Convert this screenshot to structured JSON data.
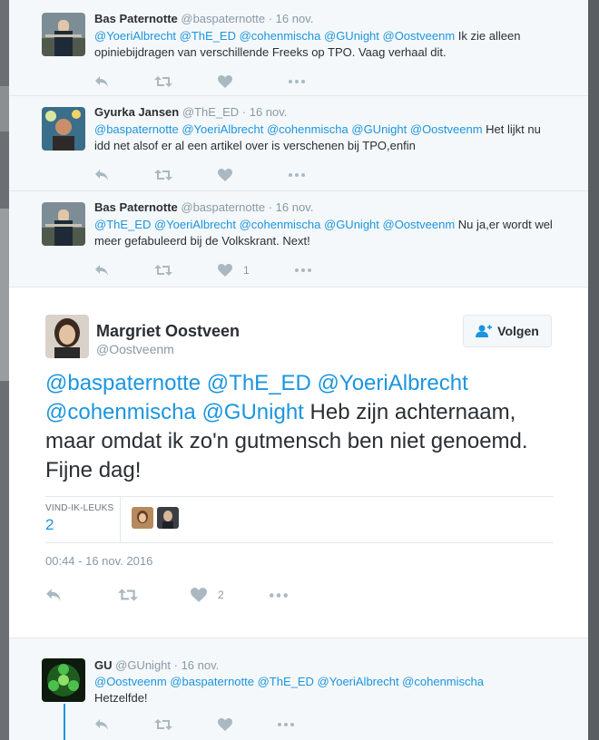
{
  "tweets": [
    {
      "name": "Bas Paternotte",
      "handle": "@baspaternotte",
      "time": "· 16 nov.",
      "mentions": "@YoeriAlbrecht @ThE_ED @cohenmischa @GUnight @Oostveenm",
      "text": " Ik zie alleen opiniebijdragen van verschillende Freeks op TPO. Vaag verhaal dit.",
      "likes": ""
    },
    {
      "name": "Gyurka Jansen",
      "handle": "@ThE_ED",
      "time": "· 16 nov.",
      "mentions": "@baspaternotte @YoeriAlbrecht @cohenmischa @GUnight @Oostveenm",
      "text": " Het lijkt nu idd net alsof er al een artikel over is verschenen bij TPO,enfin",
      "likes": ""
    },
    {
      "name": "Bas Paternotte",
      "handle": "@baspaternotte",
      "time": "· 16 nov.",
      "mentions": "@ThE_ED @YoeriAlbrecht @cohenmischa @GUnight @Oostveenm",
      "text": " Nu ja,er wordt wel meer gefabuleerd bij de Volkskrant. Next!",
      "likes": "1"
    }
  ],
  "main": {
    "name": "Margriet Oostveen",
    "handle": "@Oostveenm",
    "follow_label": "Volgen",
    "mentions": "@baspaternotte @ThE_ED @YoeriAlbrecht @cohenmischa @GUnight",
    "text": " Heb zijn achternaam, maar omdat ik zo'n gutmensch ben niet genoemd. Fijne dag!",
    "likes_label": "VIND-IK-LEUKS",
    "likes_count": "2",
    "timestamp": "00:44 - 16 nov. 2016",
    "action_likes": "2"
  },
  "reply": {
    "name": "GU",
    "handle": "@GUnight",
    "time": "· 16 nov.",
    "mentions": "@Oostveenm @baspaternotte @ThE_ED @YoeriAlbrecht @cohenmischa",
    "text": "Hetzelfde!"
  },
  "colors": {
    "accent": "#1b95e0",
    "muted": "#8899a6",
    "icon": "#aab8c2"
  }
}
